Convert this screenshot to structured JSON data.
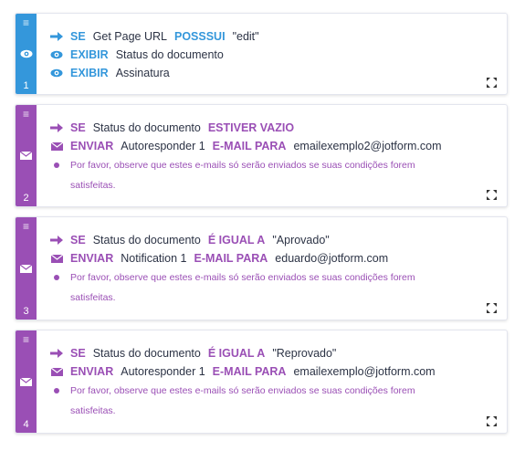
{
  "colors": {
    "blue": "#3497db",
    "purple": "#9a4fb5"
  },
  "conditions": [
    {
      "number": "1",
      "rows": [
        {
          "icon": "arrow-right-icon",
          "keyword": "SE",
          "parts": [
            {
              "type": "txt",
              "text": "Get Page URL"
            },
            {
              "type": "kw",
              "text": "POSSSUI"
            },
            {
              "type": "txt",
              "text": "\"edit\""
            }
          ]
        },
        {
          "icon": "eye-icon",
          "keyword": "EXIBIR",
          "parts": [
            {
              "type": "txt",
              "text": "Status do documento"
            }
          ]
        },
        {
          "icon": "eye-icon",
          "keyword": "EXIBIR",
          "parts": [
            {
              "type": "txt",
              "text": "Assinatura"
            }
          ]
        }
      ]
    },
    {
      "number": "2",
      "rows": [
        {
          "icon": "arrow-right-icon",
          "keyword": "SE",
          "parts": [
            {
              "type": "txt",
              "text": "Status do documento"
            },
            {
              "type": "kw",
              "text": "ESTIVER VAZIO"
            }
          ]
        },
        {
          "icon": "envelope-icon",
          "keyword": "ENVIAR",
          "parts": [
            {
              "type": "txt",
              "text": "Autoresponder 1"
            },
            {
              "type": "kw",
              "text": "E-MAIL PARA"
            },
            {
              "type": "txt",
              "text": "emailexemplo2@jotform.com"
            }
          ]
        }
      ],
      "note": "Por favor, observe que estes e-mails só serão enviados se suas condições forem satisfeitas."
    },
    {
      "number": "3",
      "rows": [
        {
          "icon": "arrow-right-icon",
          "keyword": "SE",
          "parts": [
            {
              "type": "txt",
              "text": "Status do documento"
            },
            {
              "type": "kw",
              "text": "É IGUAL A"
            },
            {
              "type": "txt",
              "text": "\"Aprovado\""
            }
          ]
        },
        {
          "icon": "envelope-icon",
          "keyword": "ENVIAR",
          "parts": [
            {
              "type": "txt",
              "text": "Notification 1"
            },
            {
              "type": "kw",
              "text": "E-MAIL PARA"
            },
            {
              "type": "txt",
              "text": "eduardo@jotform.com"
            }
          ]
        }
      ],
      "note": "Por favor, observe que estes e-mails só serão enviados se suas condições forem satisfeitas."
    },
    {
      "number": "4",
      "rows": [
        {
          "icon": "arrow-right-icon",
          "keyword": "SE",
          "parts": [
            {
              "type": "txt",
              "text": "Status do documento"
            },
            {
              "type": "kw",
              "text": "É IGUAL A"
            },
            {
              "type": "txt",
              "text": "\"Reprovado\""
            }
          ]
        },
        {
          "icon": "envelope-icon",
          "keyword": "ENVIAR",
          "parts": [
            {
              "type": "txt",
              "text": "Autoresponder 1"
            },
            {
              "type": "kw",
              "text": "E-MAIL PARA"
            },
            {
              "type": "txt",
              "text": "emailexemplo@jotform.com"
            }
          ]
        }
      ],
      "note": "Por favor, observe que estes e-mails só serão enviados se suas condições forem satisfeitas."
    }
  ]
}
